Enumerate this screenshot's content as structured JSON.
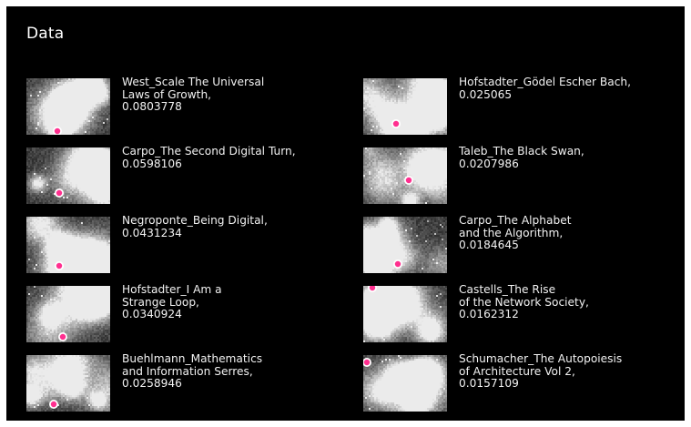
{
  "title": "Data",
  "left": [
    {
      "text": "West_Scale The Universal\nLaws of Growth,\n0.0803778",
      "seed": 11,
      "dot": [
        34,
        58
      ]
    },
    {
      "text": "Carpo_The Second Digital Turn,\n0.0598106",
      "seed": 23,
      "dot": [
        36,
        50
      ]
    },
    {
      "text": "Negroponte_Being Digital,\n0.0431234",
      "seed": 37,
      "dot": [
        36,
        54
      ]
    },
    {
      "text": "Hofstadter_I Am a\nStrange Loop,\n0.0340924",
      "seed": 41,
      "dot": [
        40,
        56
      ]
    },
    {
      "text": "Buehlmann_Mathematics\nand Information Serres,\n0.0258946",
      "seed": 53,
      "dot": [
        30,
        54
      ]
    }
  ],
  "right": [
    {
      "text": "Hofstadter_Gödel Escher Bach,\n0.025065",
      "seed": 61,
      "dot": [
        36,
        50
      ]
    },
    {
      "text": "Taleb_The Black Swan,\n0.0207986",
      "seed": 71,
      "dot": [
        50,
        36
      ]
    },
    {
      "text": "Carpo_The Alphabet\nand the Algorithm,\n0.0184645",
      "seed": 83,
      "dot": [
        38,
        52
      ]
    },
    {
      "text": "Castells_The Rise\nof the Network Society,\n0.0162312",
      "seed": 97,
      "dot": [
        10,
        2
      ]
    },
    {
      "text": "Schumacher_The Autopoiesis\nof Architecture Vol 2,\n0.0157109",
      "seed": 103,
      "dot": [
        4,
        8
      ]
    }
  ],
  "colors": {
    "background": "#000000",
    "text": "#ffffff",
    "highlight": "#ff2f8f"
  }
}
